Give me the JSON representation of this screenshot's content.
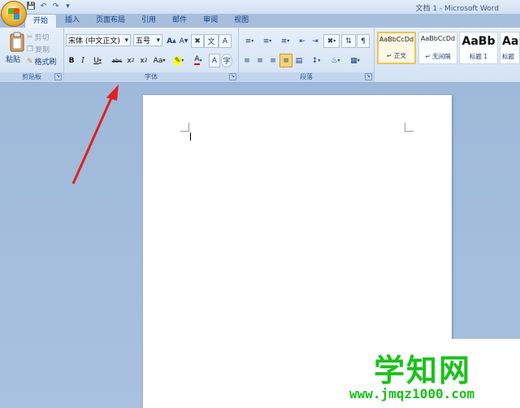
{
  "window": {
    "title": "文档 1 - Microsoft Word"
  },
  "tabs": [
    "开始",
    "插入",
    "页面布局",
    "引用",
    "邮件",
    "审阅",
    "视图"
  ],
  "clipboard": {
    "paste": "粘贴",
    "cut": "剪切",
    "copy": "复制",
    "format_painter": "格式刷",
    "group_label": "剪贴板"
  },
  "font": {
    "family": "宋体 (中文正文)",
    "size": "五号",
    "group_label": "字体"
  },
  "paragraph": {
    "group_label": "段落"
  },
  "styles": [
    {
      "sample": "AaBbCcDd",
      "name": "↵ 正文",
      "selected": true
    },
    {
      "sample": "AaBbCcDd",
      "name": "↵ 无间隔",
      "selected": false
    },
    {
      "sample": "AaBb",
      "name": "标题 1",
      "selected": false
    },
    {
      "sample": "AaB",
      "name": "标题",
      "selected": false
    }
  ],
  "watermark": {
    "text": "学知网",
    "url": "www.jmqz1000.com"
  },
  "colors": {
    "arrow": "#e02020",
    "watermark": "#19c21b",
    "highlight": "#ffff00",
    "font_color": "#e01010"
  }
}
